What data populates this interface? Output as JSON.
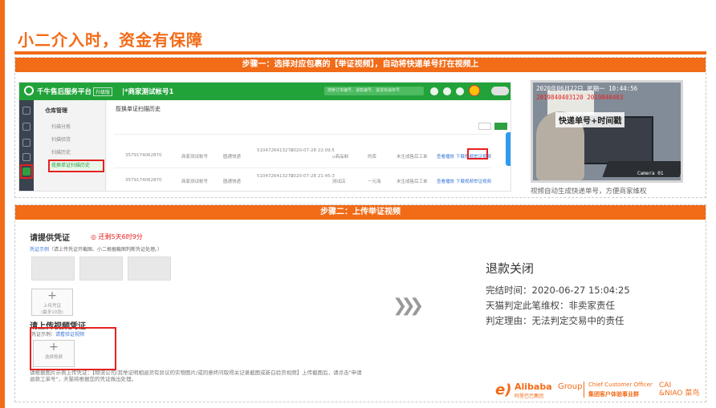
{
  "slide": {
    "title": "小二介入时，资金有保障"
  },
  "step1": {
    "header": "步骤一：选择对应包裹的【举证视频】，自动将快递单号打在视频上",
    "app": {
      "name": "千牛售后服务平台",
      "tag": "升级版",
      "account": "|*商家测试帐号1",
      "search_placeholder": "搜索订单编号、退款编号、退货快递单号",
      "sidebar": {
        "group": "仓库管理",
        "items": [
          "扫描分拣",
          "扫描验货",
          "扫描历史",
          "揽换单证扫描历史"
        ]
      },
      "main_title": "揽换单证扫描历史",
      "rows": [
        {
          "logistics_no": "3579174062870",
          "store": "商家测试帐号",
          "company": "圆通快递",
          "order_no": "5104726413270",
          "scan_time": "2020-07-28 22:09:5",
          "seller_name": "u商品制",
          "scanner": "的库",
          "status": "未生成售后工单",
          "ops": [
            "查看播放",
            "下载视频",
            "举证视频"
          ]
        },
        {
          "logistics_no": "3579174062870",
          "store": "商家测试帐号",
          "company": "圆通快递",
          "order_no": "5104726413270",
          "scan_time": "2020-07-28 21:45:3",
          "seller_name": "测试店",
          "scanner": "一元海",
          "status": "未生成售后工单",
          "ops": [
            "查看播放",
            "下载视频",
            "举证视频"
          ]
        }
      ]
    },
    "video": {
      "timestamp": "2020年06月22日 星期一 10:44:56",
      "tracking_overlay": "2019840403120  2019840403",
      "label": "快递单号+时间戳",
      "camera": "Camera 01"
    },
    "video_caption": "视频自动生成快递单号，方便商家维权"
  },
  "step2": {
    "header": "步骤二：上传举证视频",
    "form": {
      "evidence_heading": "请提供凭证",
      "countdown": "◎ 还剩5天6时9分",
      "evidence_hint_link": "凭证示例",
      "evidence_hint": "（请上传凭证开截图、小二根据截图判断凭证处理。）",
      "upload_label": "上传凭证",
      "upload_sub": "(最多10张)",
      "video_heading": "请上传视频凭证",
      "video_hint_prefix": "凭证示例：",
      "video_hint_link": "请看验证视频",
      "video_upload_label": "选择视频",
      "note": "请根据图片示例上传凭证：【物流公司/其举证明相退货有异议的实物图片/或同意终问取得关记录截图或新白验货视频】上传截图后，请点击\"申请退款工单号\"，天猫将根据您的凭证做出处理。"
    },
    "result": {
      "title": "退款关闭",
      "completed_time": "完结时间：2020-06-27 15:04:25",
      "judgment": "天猫判定此笔维权：非卖家责任",
      "reason": "判定理由：无法判定交易中的责任"
    },
    "brand": {
      "alibaba_mark": "e)",
      "alibaba": "Alibaba",
      "group": "Group",
      "alibaba_cn": "阿里巴巴集团",
      "cco": "Chief Customer Officer",
      "cco_cn": "集团客户体验事业群",
      "cainiao": "CAI\n&NIAO 菜鸟"
    }
  }
}
